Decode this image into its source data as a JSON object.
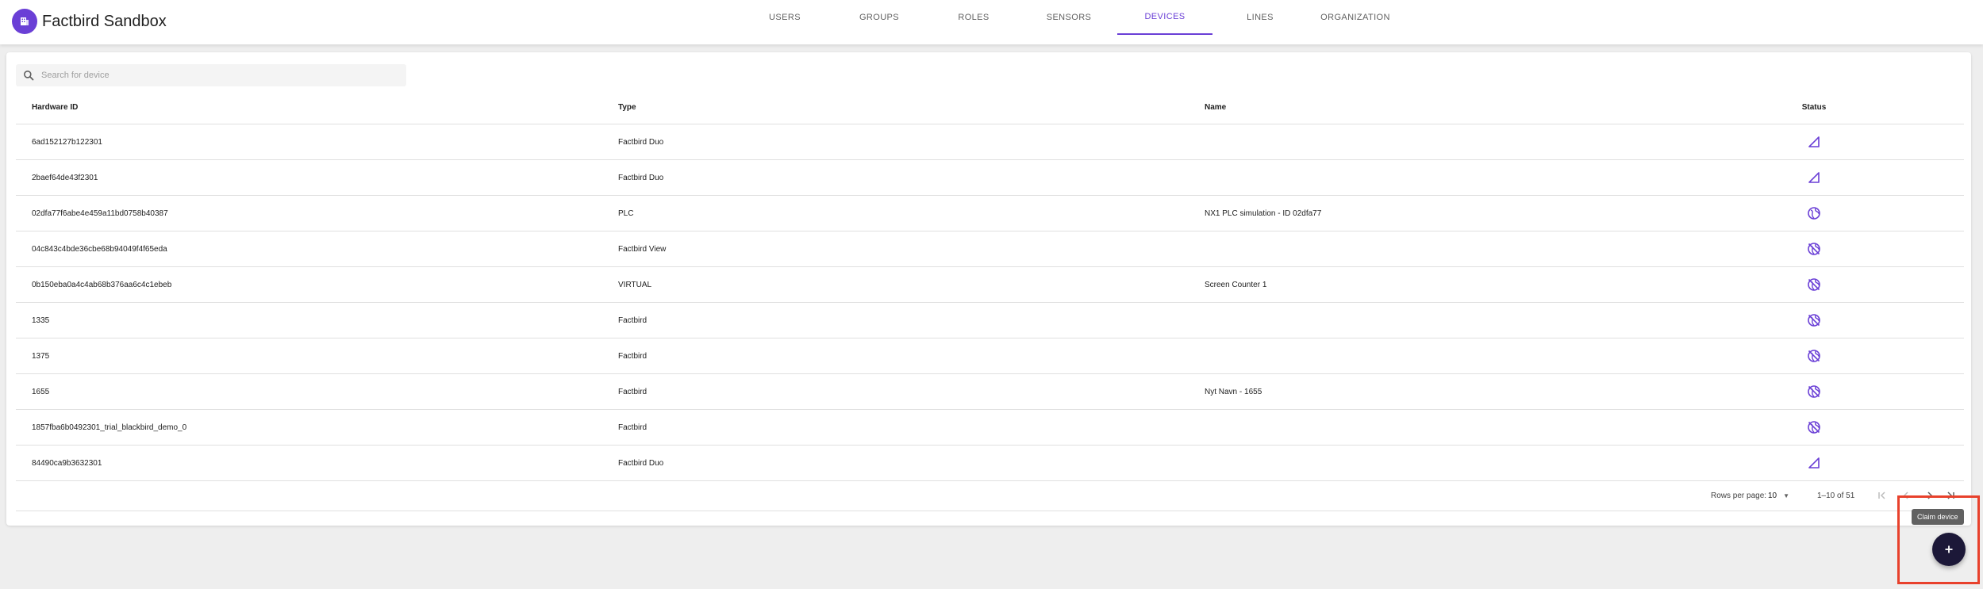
{
  "header": {
    "app_title": "Factbird Sandbox",
    "tabs": [
      {
        "label": "USERS",
        "active": false
      },
      {
        "label": "GROUPS",
        "active": false
      },
      {
        "label": "ROLES",
        "active": false
      },
      {
        "label": "SENSORS",
        "active": false
      },
      {
        "label": "DEVICES",
        "active": true
      },
      {
        "label": "LINES",
        "active": false
      },
      {
        "label": "ORGANIZATION",
        "active": false
      }
    ]
  },
  "search": {
    "placeholder": "Search for device",
    "value": ""
  },
  "table": {
    "columns": [
      "Hardware ID",
      "Type",
      "Name",
      "Status"
    ],
    "rows": [
      {
        "hardware_id": "6ad152127b122301",
        "type": "Factbird Duo",
        "name": "",
        "status": "signal-icon"
      },
      {
        "hardware_id": "2baef64de43f2301",
        "type": "Factbird Duo",
        "name": "",
        "status": "signal-icon"
      },
      {
        "hardware_id": "02dfa77f6abe4e459a11bd0758b40387",
        "type": "PLC",
        "name": "NX1 PLC simulation - ID 02dfa77",
        "status": "globe-icon"
      },
      {
        "hardware_id": "04c843c4bde36cbe68b94049f4f65eda",
        "type": "Factbird View",
        "name": "",
        "status": "globe-off-icon"
      },
      {
        "hardware_id": "0b150eba0a4c4ab68b376aa6c4c1ebeb",
        "type": "VIRTUAL",
        "name": "Screen Counter 1",
        "status": "globe-off-icon"
      },
      {
        "hardware_id": "1335",
        "type": "Factbird",
        "name": "",
        "status": "globe-off-icon"
      },
      {
        "hardware_id": "1375",
        "type": "Factbird",
        "name": "",
        "status": "globe-off-icon"
      },
      {
        "hardware_id": "1655",
        "type": "Factbird",
        "name": "Nyt Navn - 1655",
        "status": "globe-off-icon"
      },
      {
        "hardware_id": "1857fba6b0492301_trial_blackbird_demo_0",
        "type": "Factbird",
        "name": "",
        "status": "globe-off-icon"
      },
      {
        "hardware_id": "84490ca9b3632301",
        "type": "Factbird Duo",
        "name": "",
        "status": "signal-icon"
      }
    ]
  },
  "pagination": {
    "rows_per_page_label": "Rows per page:",
    "rows_per_page": "10",
    "range": "1–10 of 51"
  },
  "fab": {
    "tooltip": "Claim device",
    "icon": "plus-icon"
  },
  "colors": {
    "accent": "#6a3fd6",
    "fab": "#1c1838",
    "highlight": "#e8412c"
  }
}
